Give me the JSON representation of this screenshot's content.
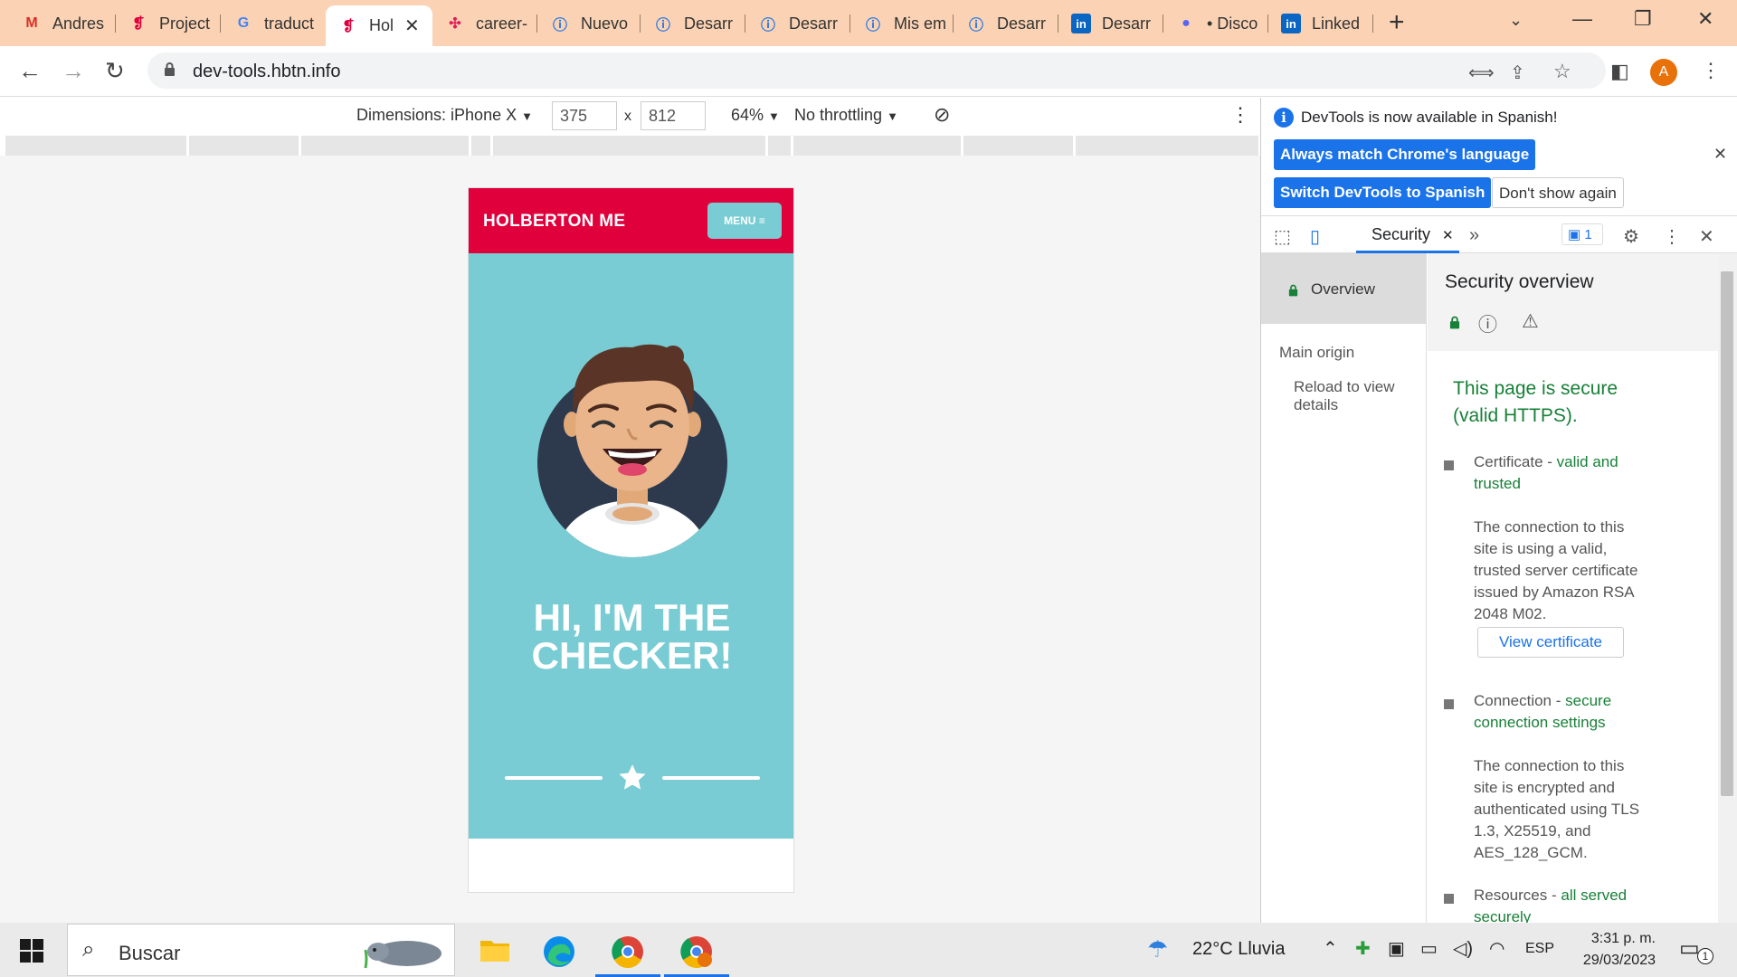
{
  "tabs": [
    {
      "title": "Andres",
      "icon": "gmail-icon"
    },
    {
      "title": "Project",
      "icon": "holberton-icon"
    },
    {
      "title": "traduct",
      "icon": "google-icon"
    },
    {
      "title": "Hol",
      "icon": "holberton-icon",
      "active": true
    },
    {
      "title": "career-",
      "icon": "slack-icon"
    },
    {
      "title": "Nuevo",
      "icon": "info-icon"
    },
    {
      "title": "Desarr",
      "icon": "info-icon"
    },
    {
      "title": "Desarr",
      "icon": "info-icon"
    },
    {
      "title": "Mis em",
      "icon": "info-icon"
    },
    {
      "title": "Desarr",
      "icon": "info-icon"
    },
    {
      "title": "Desarr",
      "icon": "linkedin-icon"
    },
    {
      "title": "• Disco",
      "icon": "chrome-profile-icon"
    },
    {
      "title": "Linked",
      "icon": "linkedin-icon"
    }
  ],
  "address": {
    "url": "dev-tools.hbtn.info"
  },
  "profile": {
    "initial": "A"
  },
  "device_toolbar": {
    "dimensions_label": "Dimensions: iPhone X",
    "width": "375",
    "height": "812",
    "times": "x",
    "zoom": "64%",
    "throttling": "No throttling"
  },
  "phone": {
    "brand": "HOLBERTON ME",
    "menu_label": "MENU",
    "title_line1": "HI, I'M THE",
    "title_line2": "CHECKER!"
  },
  "devtools": {
    "infobar_message": "DevTools is now available in Spanish!",
    "btn_match_language": "Always match Chrome's language",
    "btn_switch_spanish": "Switch DevTools to Spanish",
    "btn_dont_show": "Don't show again",
    "active_tab": "Security",
    "issues_count": "1",
    "sidebar": {
      "overview": "Overview",
      "main_origin": "Main origin",
      "reload": "Reload to view details"
    },
    "main": {
      "heading": "Security overview",
      "secure_line1": "This page is secure",
      "secure_line2": "(valid HTTPS).",
      "certificate": {
        "label": "Certificate - ",
        "status_l1": "valid and",
        "status_l2": "trusted",
        "desc": [
          "The connection to this",
          "site is using a valid,",
          "trusted server certificate",
          "issued by Amazon RSA",
          "2048 M02."
        ],
        "button": "View certificate"
      },
      "connection": {
        "label": "Connection - ",
        "status_l1": "secure",
        "status_l2": "connection settings",
        "desc": [
          "The connection to this",
          "site is encrypted and",
          "authenticated using TLS",
          "1.3, X25519, and",
          "AES_128_GCM."
        ]
      },
      "resources": {
        "label": "Resources - ",
        "status_l1": "all served",
        "status_l2": "securely"
      }
    }
  },
  "taskbar": {
    "search_placeholder": "Buscar",
    "weather": "22°C  Lluvia",
    "language": "ESP",
    "time": "3:31 p. m.",
    "date": "29/03/2023",
    "notifications": "1"
  },
  "colors": {
    "tabstrip": "#fbd3b4",
    "holberton_red": "#e0003c",
    "hero_teal": "#79ccd3",
    "devtools_blue": "#1a73e8",
    "secure_green": "#188038"
  }
}
